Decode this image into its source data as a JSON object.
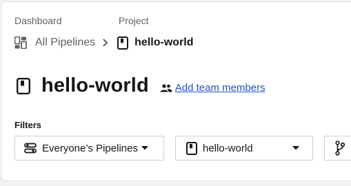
{
  "breadcrumb": {
    "dashboard_label": "Dashboard",
    "project_label": "Project",
    "all_pipelines": "All Pipelines",
    "project_name": "hello-world"
  },
  "header": {
    "title": "hello-world",
    "add_team_members": "Add team members"
  },
  "filters": {
    "label": "Filters",
    "pipelines_filter": "Everyone’s Pipelines",
    "project_filter": "hello-world"
  },
  "icons": {
    "dashboard": "dashboard-grid-icon",
    "project": "project-book-icon",
    "people": "people-icon",
    "pipelines_filter": "filter-toggle-icon",
    "branch": "branch-icon",
    "caret": "caret-down-icon",
    "chevron": "chevron-right-icon"
  },
  "colors": {
    "link": "#2152c9",
    "muted": "#606060",
    "text": "#161616"
  }
}
